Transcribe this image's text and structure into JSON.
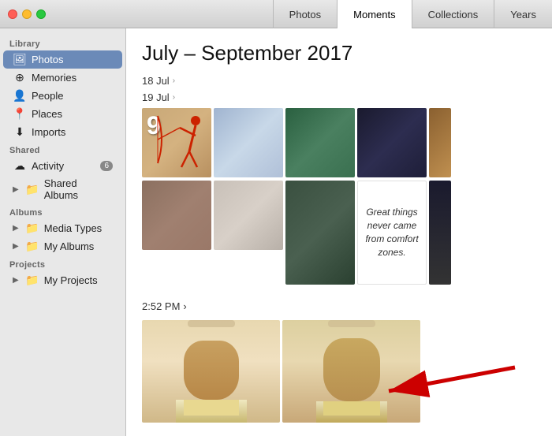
{
  "titleBar": {
    "tabs": [
      {
        "id": "photos",
        "label": "Photos",
        "active": false
      },
      {
        "id": "moments",
        "label": "Moments",
        "active": true
      },
      {
        "id": "collections",
        "label": "Collections",
        "active": false
      },
      {
        "id": "years",
        "label": "Years",
        "active": false
      }
    ]
  },
  "sidebar": {
    "sections": [
      {
        "label": "Library",
        "items": [
          {
            "id": "photos",
            "icon": "📷",
            "label": "Photos",
            "active": true,
            "badge": null,
            "arrow": null
          },
          {
            "id": "memories",
            "icon": "⏰",
            "label": "Memories",
            "active": false,
            "badge": null,
            "arrow": null
          },
          {
            "id": "people",
            "icon": "👤",
            "label": "People",
            "active": false,
            "badge": null,
            "arrow": null
          },
          {
            "id": "places",
            "icon": "📍",
            "label": "Places",
            "active": false,
            "badge": null,
            "arrow": null
          },
          {
            "id": "imports",
            "icon": "⬇",
            "label": "Imports",
            "active": false,
            "badge": null,
            "arrow": null
          }
        ]
      },
      {
        "label": "Shared",
        "items": [
          {
            "id": "activity",
            "icon": "☁",
            "label": "Activity",
            "active": false,
            "badge": "6",
            "arrow": null
          },
          {
            "id": "shared-albums",
            "icon": "📁",
            "label": "Shared Albums",
            "active": false,
            "badge": null,
            "arrow": "▶"
          }
        ]
      },
      {
        "label": "Albums",
        "items": [
          {
            "id": "media-types",
            "icon": "📁",
            "label": "Media Types",
            "active": false,
            "badge": null,
            "arrow": "▶"
          },
          {
            "id": "my-albums",
            "icon": "📁",
            "label": "My Albums",
            "active": false,
            "badge": null,
            "arrow": "▶"
          }
        ]
      },
      {
        "label": "Projects",
        "items": [
          {
            "id": "my-projects",
            "icon": "📁",
            "label": "My Projects",
            "active": false,
            "badge": null,
            "arrow": "▶"
          }
        ]
      }
    ]
  },
  "content": {
    "title": "July – September 2017",
    "moments": [
      {
        "date": "18 Jul",
        "hasChevron": true
      },
      {
        "date": "19 Jul",
        "hasChevron": true
      }
    ],
    "timeSection": {
      "time": "2:52 PM",
      "hasChevron": true
    },
    "quoteText": "Great things never came from comfort zones.",
    "arrowAlt": "Red arrow pointing to second selfie"
  }
}
